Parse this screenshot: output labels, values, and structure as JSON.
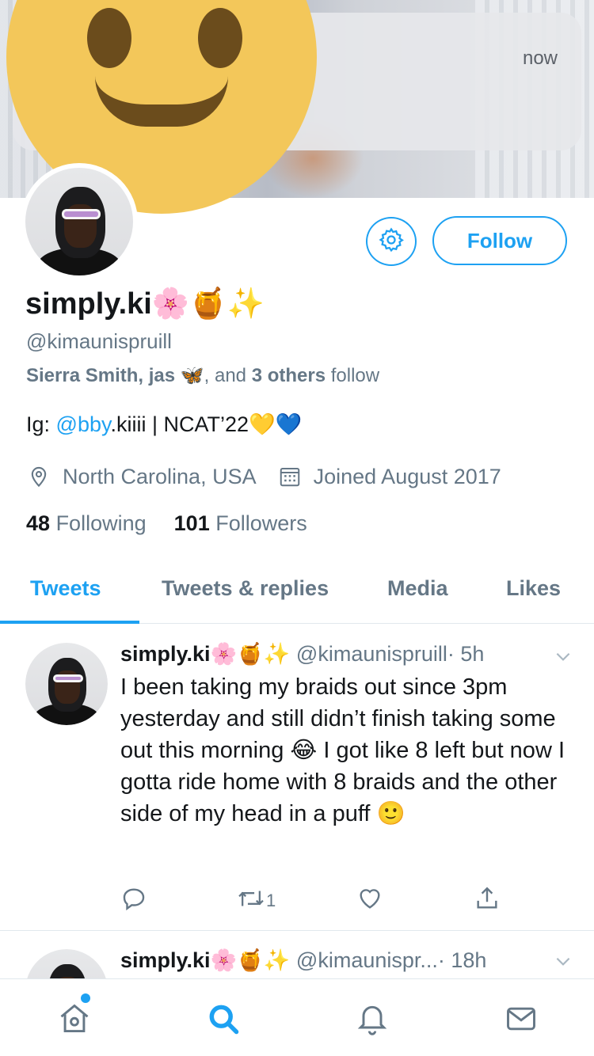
{
  "notification": {
    "time": "now"
  },
  "profile": {
    "name": "simply.ki🌸🍯✨",
    "handle": "@kimaunispruill",
    "followed_by": {
      "names": "Sierra Smith, jas 🦋",
      "joiner": ", and ",
      "others": "3 others",
      "suffix": " follow"
    },
    "bio": {
      "prefix": "Ig: ",
      "mention": "@bby",
      "suffix": ".kiiii | NCAT’22💛💙"
    },
    "location": "North Carolina, USA",
    "joined": "Joined August 2017",
    "following_count": "48",
    "following_label": "Following",
    "followers_count": "101",
    "followers_label": "Followers",
    "follow_label": "Follow"
  },
  "tabs": [
    "Tweets",
    "Tweets & replies",
    "Media",
    "Likes"
  ],
  "active_tab": "Tweets",
  "tweets": [
    {
      "name": "simply.ki🌸🍯✨",
      "handle": "@kimaunispruill",
      "time": "· 5h",
      "text": "I been taking my braids out since 3pm yesterday and still didn’t finish  taking some out this morning 😂 I got like 8 left but now I gotta ride home with 8 braids and the other side of my head in a puff 🙂",
      "retweets": "1"
    },
    {
      "name": "simply.ki🌸🍯✨",
      "handle": "@kimaunispr...",
      "time": "· 18h"
    }
  ],
  "colors": {
    "accent": "#1da1f2",
    "secondary_text": "#657786",
    "primary_text": "#14171a"
  },
  "nav_icons": [
    "home-icon",
    "search-icon",
    "notifications-icon",
    "messages-icon"
  ]
}
